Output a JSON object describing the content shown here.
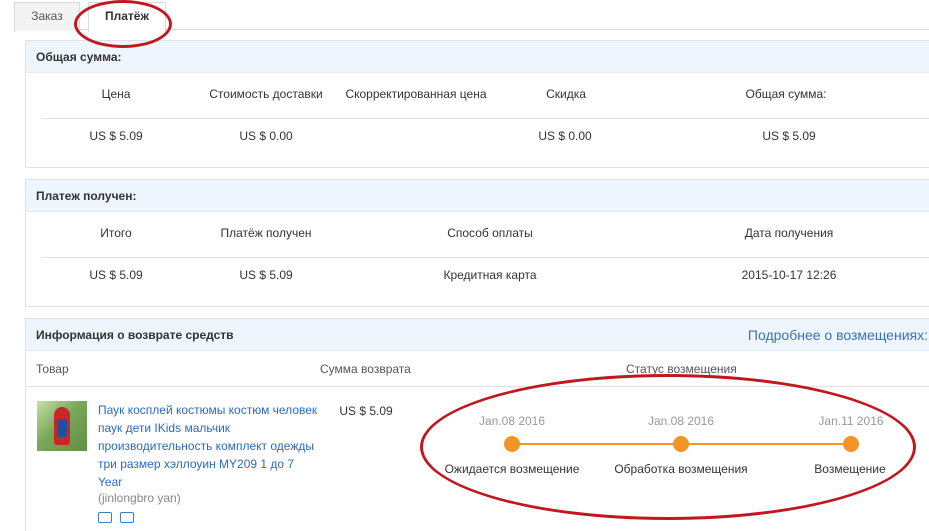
{
  "tabs": [
    {
      "label": "Заказ"
    },
    {
      "label": "Платёж"
    }
  ],
  "total": {
    "title": "Общая сумма:",
    "columns": [
      "Цена",
      "Стоимость доставки",
      "Скорректированная цена",
      "Скидка",
      "Общая сумма:"
    ],
    "values": [
      "US $ 5.09",
      "US $ 0.00",
      "",
      "US $ 0.00",
      "US $ 5.09"
    ]
  },
  "payment": {
    "title": "Платеж получен:",
    "columns": [
      "Итого",
      "Платёж получен",
      "Способ оплаты",
      "Дата получения"
    ],
    "values": [
      "US $ 5.09",
      "US $ 5.09",
      "Кредитная карта",
      "2015-10-17 12:26"
    ]
  },
  "refund": {
    "title": "Информация о возврате средств",
    "link": "Подробнее о возмещениях:",
    "headers": {
      "product": "Товар",
      "amount": "Сумма возврата",
      "status": "Статус возмещения"
    },
    "product_title": "Паук косплей костюмы костюм человек паук дети IKids мальчик производительность комплект одежды три размер хэллоуин MY209 1 до 7 Year",
    "seller": "(jinlongbro yan)",
    "amount": "US $ 5.09",
    "timeline": [
      {
        "date": "Jan.08 2016",
        "label": "Ожидается возмещение"
      },
      {
        "date": "Jan.08 2016",
        "label": "Обработка возмещения"
      },
      {
        "date": "Jan.11 2016",
        "label": "Возмещение"
      }
    ]
  },
  "colors": {
    "accent": "#f39426",
    "link": "#3a72b8",
    "annotation": "#c0181e",
    "panel_header": "#eef5fc"
  }
}
